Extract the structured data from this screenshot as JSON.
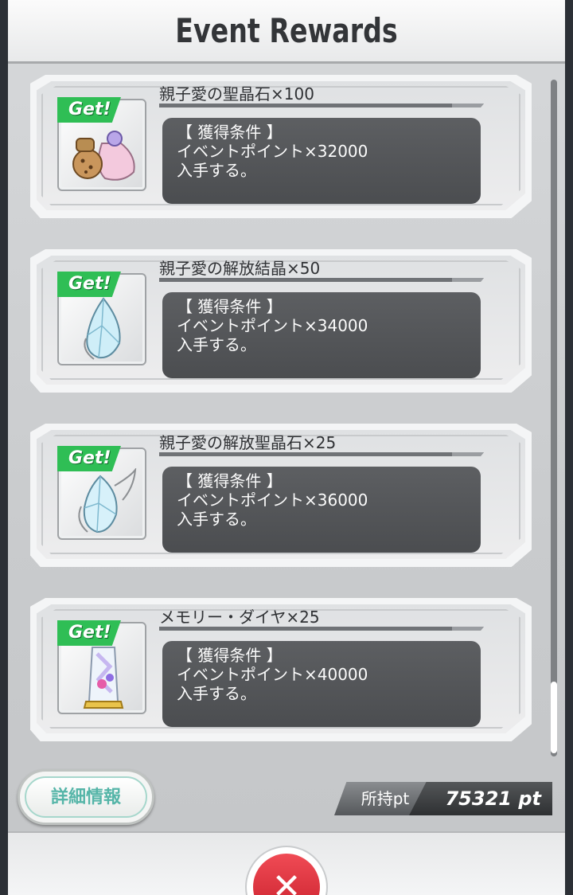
{
  "header": {
    "title": "Event Rewards"
  },
  "rewards": [
    {
      "tag": "Get!",
      "name": "親子愛の聖晶石×100",
      "cond_title": "【 獲得条件 】",
      "cond_line": "イベントポイント×32000",
      "cond_tail": "入手する。",
      "icon": "gem-bag-icon"
    },
    {
      "tag": "Get!",
      "name": "親子愛の解放結晶×50",
      "cond_title": "【 獲得条件 】",
      "cond_line": "イベントポイント×34000",
      "cond_tail": "入手する。",
      "icon": "crystal-icon"
    },
    {
      "tag": "Get!",
      "name": "親子愛の解放聖晶石×25",
      "cond_title": "【 獲得条件 】",
      "cond_line": "イベントポイント×36000",
      "cond_tail": "入手する。",
      "icon": "winged-crystal-icon"
    },
    {
      "tag": "Get!",
      "name": "メモリー・ダイヤ×25",
      "cond_title": "【 獲得条件 】",
      "cond_line": "イベントポイント×40000",
      "cond_tail": "入手する。",
      "icon": "memory-diamond-icon"
    }
  ],
  "footer": {
    "detail_label": "詳細情報",
    "points_label": "所持pt",
    "points_value": "75321 pt",
    "close_label": "✕"
  },
  "colors": {
    "get_tag": "#2fbe55",
    "close": "#d92c38",
    "detail_text": "#55b5a8"
  }
}
